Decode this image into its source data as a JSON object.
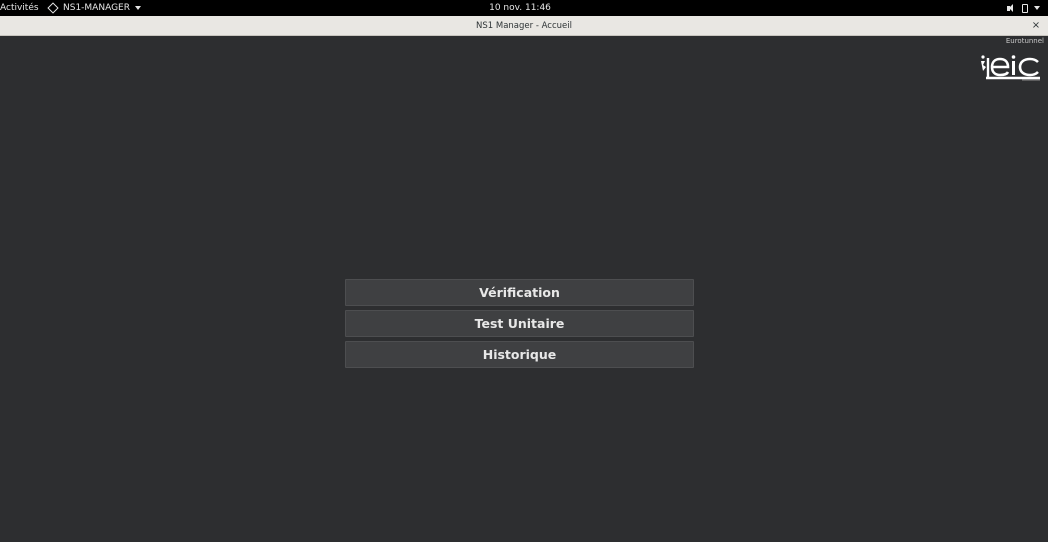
{
  "topbar": {
    "activities": "Activités",
    "app_name": "NS1-MANAGER",
    "clock": "10 nov.  11:46",
    "icons": [
      "speaker-icon",
      "battery-icon",
      "chevron-down-icon"
    ]
  },
  "window": {
    "title": "NS1 Manager - Accueil",
    "close_label": "×"
  },
  "header": {
    "company": "Eurotunnel",
    "logo_text": "eic"
  },
  "menu": {
    "items": [
      {
        "label": "Vérification"
      },
      {
        "label": "Test Unitaire"
      },
      {
        "label": "Historique"
      }
    ]
  },
  "colors": {
    "background": "#2d2e30",
    "button": "#3f4042",
    "topbar": "#000000",
    "titlebar": "#e9e7e3"
  }
}
